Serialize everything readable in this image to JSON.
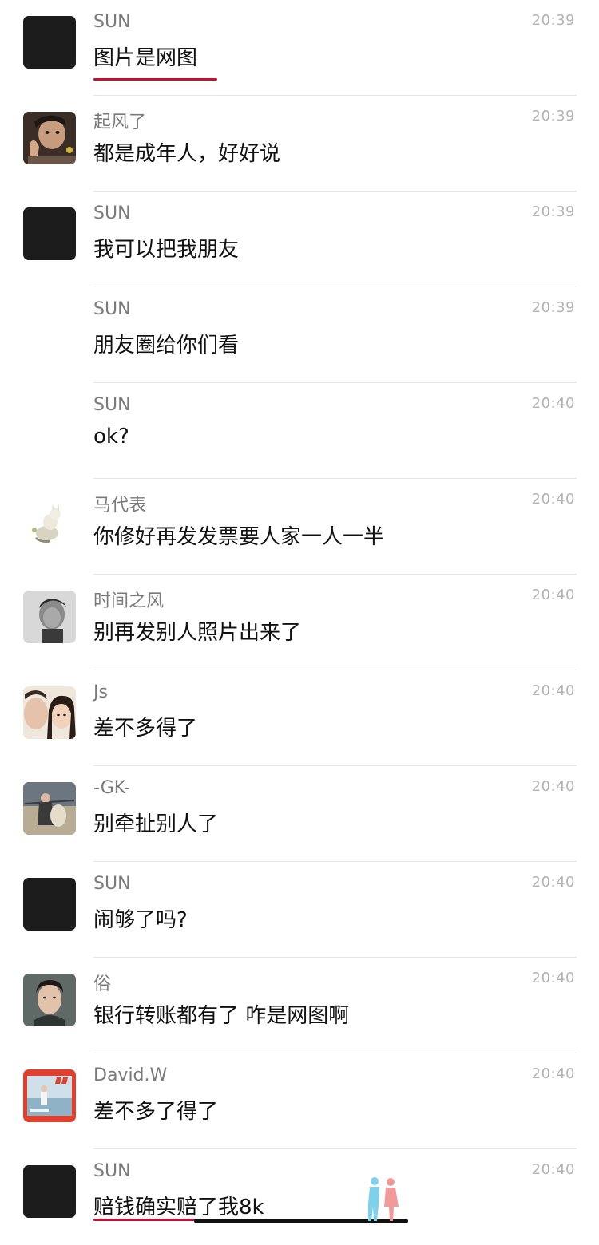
{
  "messages": [
    {
      "sender": "SUN",
      "time": "20:39",
      "text": "图片是网图",
      "avatar": "dark",
      "avatar_icon": "dark-square-avatar"
    },
    {
      "sender": "起风了",
      "time": "20:39",
      "text": "都是成年人，好好说",
      "avatar": "photo-child",
      "avatar_icon": "child-photo-avatar"
    },
    {
      "sender": "SUN",
      "time": "20:39",
      "text": "我可以把我朋友",
      "avatar": "dark",
      "avatar_icon": "dark-square-avatar"
    },
    {
      "sender": "SUN",
      "time": "20:39",
      "text": "朋友圈给你们看",
      "avatar": "none",
      "avatar_icon": "none"
    },
    {
      "sender": "SUN",
      "time": "20:40",
      "text": "ok?",
      "avatar": "none",
      "avatar_icon": "none"
    },
    {
      "sender": "马代表",
      "time": "20:40",
      "text": "你修好再发发票要人家一人一半",
      "avatar": "cat",
      "avatar_icon": "cat-avatar"
    },
    {
      "sender": "时间之风",
      "time": "20:40",
      "text": "别再发别人照片出来了",
      "avatar": "bw-portrait",
      "avatar_icon": "bw-portrait-avatar"
    },
    {
      "sender": "Js",
      "time": "20:40",
      "text": "差不多得了",
      "avatar": "couple",
      "avatar_icon": "couple-selfie-avatar"
    },
    {
      "sender": "-GK-",
      "time": "20:40",
      "text": "别牵扯别人了",
      "avatar": "outdoor",
      "avatar_icon": "outdoor-photo-avatar"
    },
    {
      "sender": "SUN",
      "time": "20:40",
      "text": "闹够了吗?",
      "avatar": "dark",
      "avatar_icon": "dark-square-avatar"
    },
    {
      "sender": "俗",
      "time": "20:40",
      "text": "银行转账都有了 咋是网图啊",
      "avatar": "man-portrait",
      "avatar_icon": "man-portrait-avatar"
    },
    {
      "sender": "David.W",
      "time": "20:40",
      "text": "差不多了得了",
      "avatar": "red-poster",
      "avatar_icon": "red-poster-avatar"
    },
    {
      "sender": "SUN",
      "time": "20:40",
      "text": "赔钱确实赔了我8k",
      "avatar": "dark",
      "avatar_icon": "dark-square-avatar"
    }
  ],
  "colors": {
    "highlight": "#c4122e",
    "divider": "#e6e6e6",
    "sender": "#7a7a7a",
    "time": "#b3b3b3"
  }
}
